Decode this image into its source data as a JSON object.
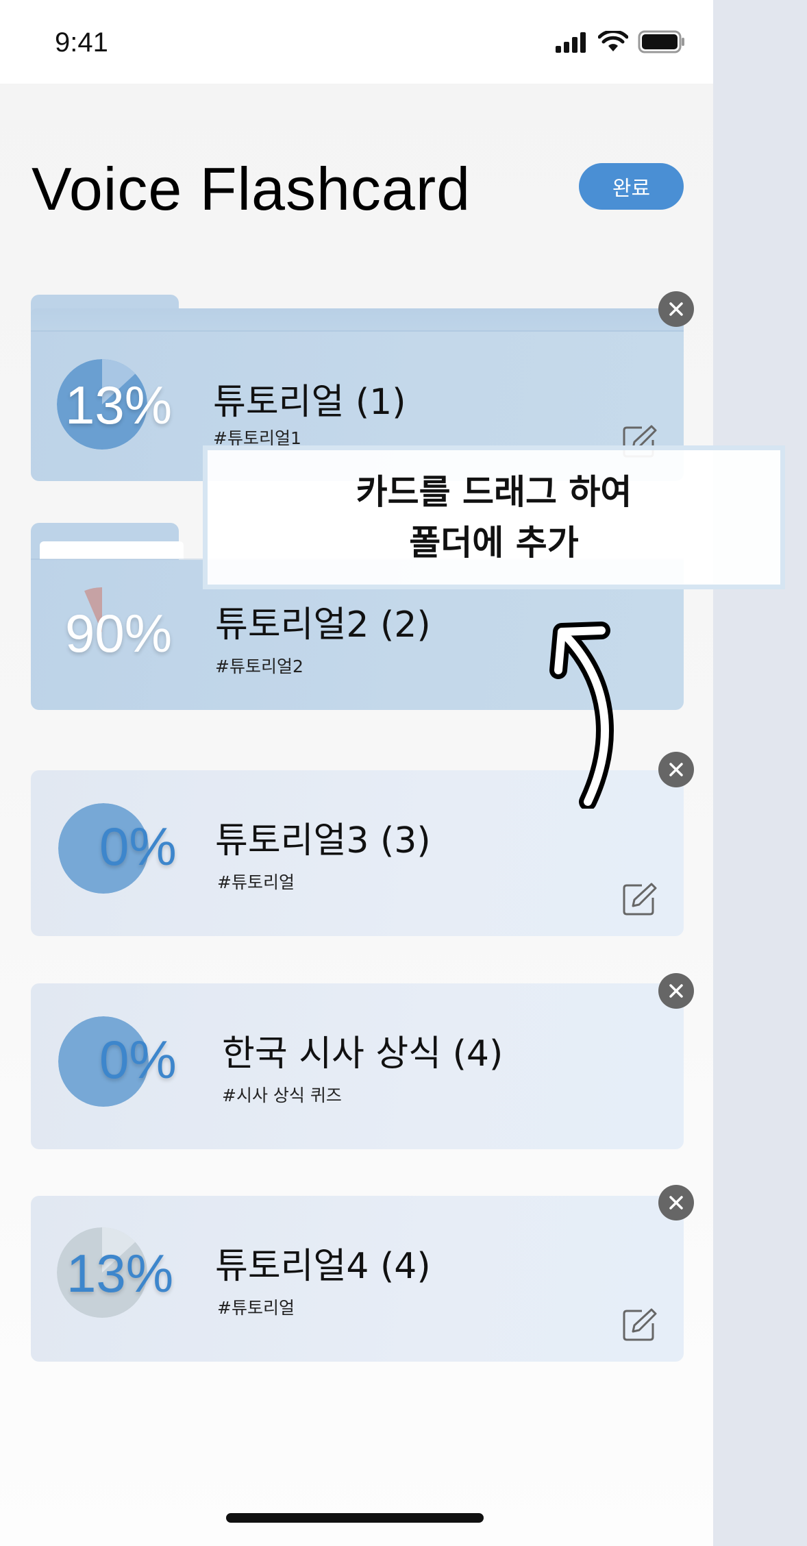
{
  "status_bar": {
    "time": "9:41"
  },
  "header": {
    "title": "Voice Flashcard",
    "done_label": "완료"
  },
  "cards": [
    {
      "kind": "folder",
      "percent": "13%",
      "progress": 0.13,
      "title": "튜토리얼 (1)",
      "tag": "#튜토리얼1"
    },
    {
      "kind": "folder",
      "percent": "90%",
      "progress": 0.9,
      "title": "튜토리얼2 (2)",
      "tag": "#튜토리얼2"
    },
    {
      "kind": "card",
      "percent": "0%",
      "progress": 0.0,
      "title": "튜토리얼3 (3)",
      "tag": "#튜토리얼"
    },
    {
      "kind": "card",
      "percent": "0%",
      "progress": 0.0,
      "title": "한국 시사 상식 (4)",
      "tag": "#시사 상식 퀴즈"
    },
    {
      "kind": "card",
      "percent": "13%",
      "progress": 0.13,
      "title": "튜토리얼4 (4)",
      "tag": "#튜토리얼"
    }
  ],
  "tooltip": {
    "line1": "카드를 드래그 하여",
    "line2": "폴더에 추가"
  },
  "colors": {
    "accent": "#4a8fd4",
    "percent_blue": "#3d86cc",
    "close_gray": "#666666"
  },
  "icons": [
    "signal-icon",
    "wifi-icon",
    "battery-icon",
    "close-icon",
    "edit-icon",
    "curved-arrow-icon"
  ]
}
